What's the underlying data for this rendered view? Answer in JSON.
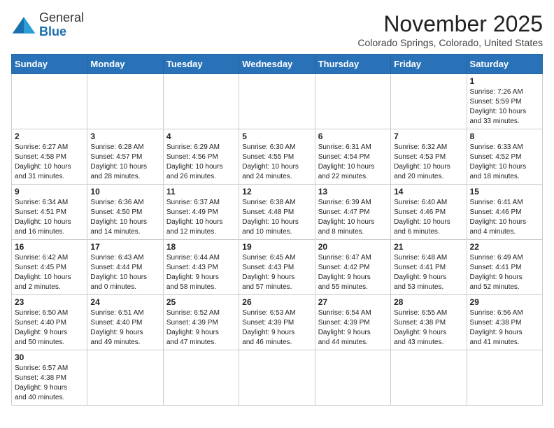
{
  "header": {
    "logo_line1": "General",
    "logo_line2": "Blue",
    "month": "November 2025",
    "location": "Colorado Springs, Colorado, United States"
  },
  "weekdays": [
    "Sunday",
    "Monday",
    "Tuesday",
    "Wednesday",
    "Thursday",
    "Friday",
    "Saturday"
  ],
  "weeks": [
    [
      {
        "day": "",
        "info": ""
      },
      {
        "day": "",
        "info": ""
      },
      {
        "day": "",
        "info": ""
      },
      {
        "day": "",
        "info": ""
      },
      {
        "day": "",
        "info": ""
      },
      {
        "day": "",
        "info": ""
      },
      {
        "day": "1",
        "info": "Sunrise: 7:26 AM\nSunset: 5:59 PM\nDaylight: 10 hours\nand 33 minutes."
      }
    ],
    [
      {
        "day": "2",
        "info": "Sunrise: 6:27 AM\nSunset: 4:58 PM\nDaylight: 10 hours\nand 31 minutes."
      },
      {
        "day": "3",
        "info": "Sunrise: 6:28 AM\nSunset: 4:57 PM\nDaylight: 10 hours\nand 28 minutes."
      },
      {
        "day": "4",
        "info": "Sunrise: 6:29 AM\nSunset: 4:56 PM\nDaylight: 10 hours\nand 26 minutes."
      },
      {
        "day": "5",
        "info": "Sunrise: 6:30 AM\nSunset: 4:55 PM\nDaylight: 10 hours\nand 24 minutes."
      },
      {
        "day": "6",
        "info": "Sunrise: 6:31 AM\nSunset: 4:54 PM\nDaylight: 10 hours\nand 22 minutes."
      },
      {
        "day": "7",
        "info": "Sunrise: 6:32 AM\nSunset: 4:53 PM\nDaylight: 10 hours\nand 20 minutes."
      },
      {
        "day": "8",
        "info": "Sunrise: 6:33 AM\nSunset: 4:52 PM\nDaylight: 10 hours\nand 18 minutes."
      }
    ],
    [
      {
        "day": "9",
        "info": "Sunrise: 6:34 AM\nSunset: 4:51 PM\nDaylight: 10 hours\nand 16 minutes."
      },
      {
        "day": "10",
        "info": "Sunrise: 6:36 AM\nSunset: 4:50 PM\nDaylight: 10 hours\nand 14 minutes."
      },
      {
        "day": "11",
        "info": "Sunrise: 6:37 AM\nSunset: 4:49 PM\nDaylight: 10 hours\nand 12 minutes."
      },
      {
        "day": "12",
        "info": "Sunrise: 6:38 AM\nSunset: 4:48 PM\nDaylight: 10 hours\nand 10 minutes."
      },
      {
        "day": "13",
        "info": "Sunrise: 6:39 AM\nSunset: 4:47 PM\nDaylight: 10 hours\nand 8 minutes."
      },
      {
        "day": "14",
        "info": "Sunrise: 6:40 AM\nSunset: 4:46 PM\nDaylight: 10 hours\nand 6 minutes."
      },
      {
        "day": "15",
        "info": "Sunrise: 6:41 AM\nSunset: 4:46 PM\nDaylight: 10 hours\nand 4 minutes."
      }
    ],
    [
      {
        "day": "16",
        "info": "Sunrise: 6:42 AM\nSunset: 4:45 PM\nDaylight: 10 hours\nand 2 minutes."
      },
      {
        "day": "17",
        "info": "Sunrise: 6:43 AM\nSunset: 4:44 PM\nDaylight: 10 hours\nand 0 minutes."
      },
      {
        "day": "18",
        "info": "Sunrise: 6:44 AM\nSunset: 4:43 PM\nDaylight: 9 hours\nand 58 minutes."
      },
      {
        "day": "19",
        "info": "Sunrise: 6:45 AM\nSunset: 4:43 PM\nDaylight: 9 hours\nand 57 minutes."
      },
      {
        "day": "20",
        "info": "Sunrise: 6:47 AM\nSunset: 4:42 PM\nDaylight: 9 hours\nand 55 minutes."
      },
      {
        "day": "21",
        "info": "Sunrise: 6:48 AM\nSunset: 4:41 PM\nDaylight: 9 hours\nand 53 minutes."
      },
      {
        "day": "22",
        "info": "Sunrise: 6:49 AM\nSunset: 4:41 PM\nDaylight: 9 hours\nand 52 minutes."
      }
    ],
    [
      {
        "day": "23",
        "info": "Sunrise: 6:50 AM\nSunset: 4:40 PM\nDaylight: 9 hours\nand 50 minutes."
      },
      {
        "day": "24",
        "info": "Sunrise: 6:51 AM\nSunset: 4:40 PM\nDaylight: 9 hours\nand 49 minutes."
      },
      {
        "day": "25",
        "info": "Sunrise: 6:52 AM\nSunset: 4:39 PM\nDaylight: 9 hours\nand 47 minutes."
      },
      {
        "day": "26",
        "info": "Sunrise: 6:53 AM\nSunset: 4:39 PM\nDaylight: 9 hours\nand 46 minutes."
      },
      {
        "day": "27",
        "info": "Sunrise: 6:54 AM\nSunset: 4:39 PM\nDaylight: 9 hours\nand 44 minutes."
      },
      {
        "day": "28",
        "info": "Sunrise: 6:55 AM\nSunset: 4:38 PM\nDaylight: 9 hours\nand 43 minutes."
      },
      {
        "day": "29",
        "info": "Sunrise: 6:56 AM\nSunset: 4:38 PM\nDaylight: 9 hours\nand 41 minutes."
      }
    ],
    [
      {
        "day": "30",
        "info": "Sunrise: 6:57 AM\nSunset: 4:38 PM\nDaylight: 9 hours\nand 40 minutes."
      },
      {
        "day": "",
        "info": ""
      },
      {
        "day": "",
        "info": ""
      },
      {
        "day": "",
        "info": ""
      },
      {
        "day": "",
        "info": ""
      },
      {
        "day": "",
        "info": ""
      },
      {
        "day": "",
        "info": ""
      }
    ]
  ]
}
